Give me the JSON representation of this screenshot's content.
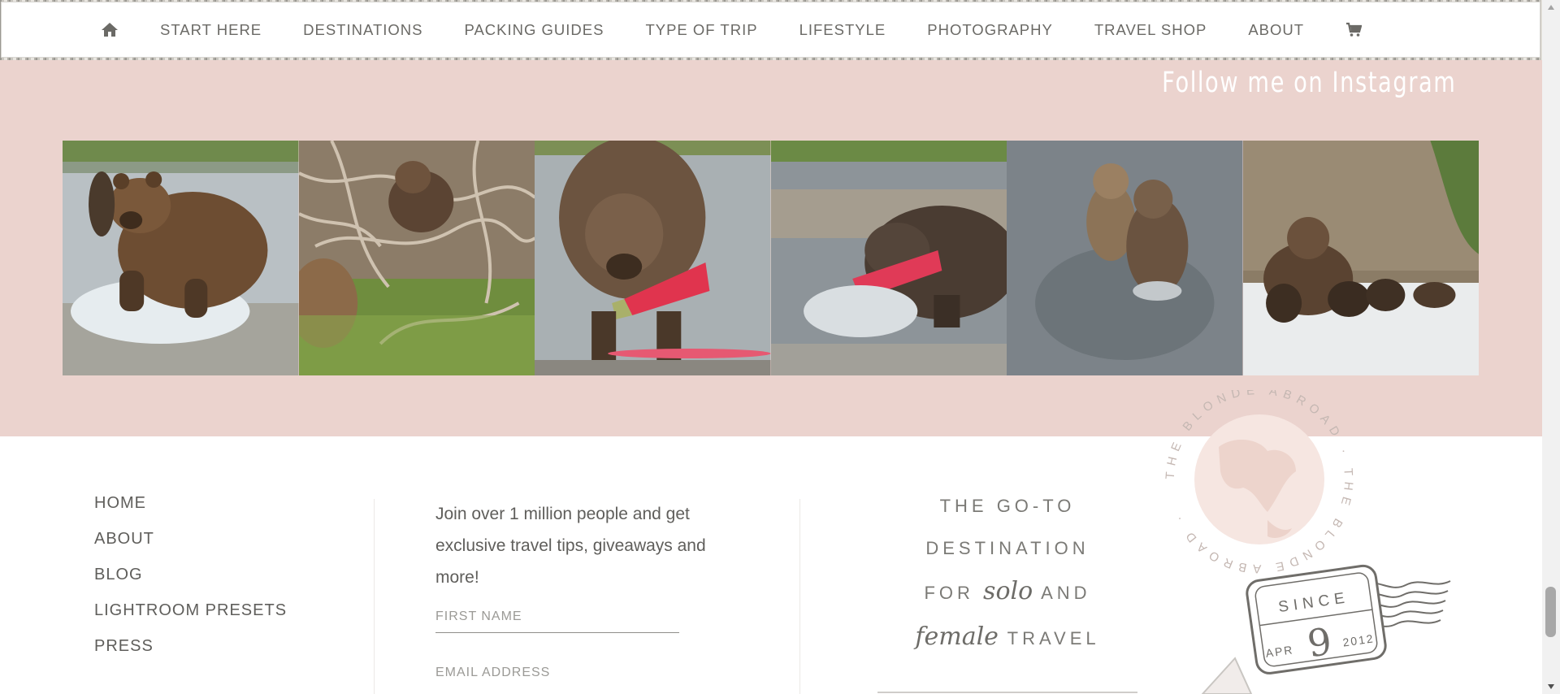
{
  "nav": {
    "home_icon": "home-icon",
    "items": [
      "START HERE",
      "DESTINATIONS",
      "PACKING GUIDES",
      "TYPE OF TRIP",
      "LIFESTYLE",
      "PHOTOGRAPHY",
      "TRAVEL SHOP",
      "ABOUT"
    ],
    "cart_icon": "cart-icon"
  },
  "instagram": {
    "title": "Follow me on Instagram",
    "photos": [
      "bear running through river",
      "bear cub climbing branches",
      "bear eating red salmon",
      "bear catching salmon in rapids",
      "two bear cubs in water",
      "mother bear with cubs on snow"
    ]
  },
  "footer": {
    "links": [
      "HOME",
      "ABOUT",
      "BLOG",
      "LIGHTROOM PRESETS",
      "PRESS"
    ],
    "newsletter": {
      "text": "Join over 1 million people and get exclusive travel tips, giveaways and more!",
      "first_name_placeholder": "FIRST NAME",
      "email_placeholder": "EMAIL ADDRESS"
    },
    "tagline": {
      "line1": "THE GO-TO",
      "line2": "DESTINATION",
      "line3_pre": "FOR",
      "line3_script": "solo",
      "line3_post": "AND",
      "line4_script": "female",
      "line4_post": "TRAVEL"
    },
    "stamp": {
      "ring_text": "THE BLONDE ABROAD · THE BLONDE ABROAD ·",
      "since": "SINCE",
      "month": "APR",
      "day": "9",
      "year": "2012"
    }
  },
  "colors": {
    "band_pink": "#ebd3ce",
    "nav_text": "#6b6a66",
    "footer_text": "#5f5e5b"
  }
}
